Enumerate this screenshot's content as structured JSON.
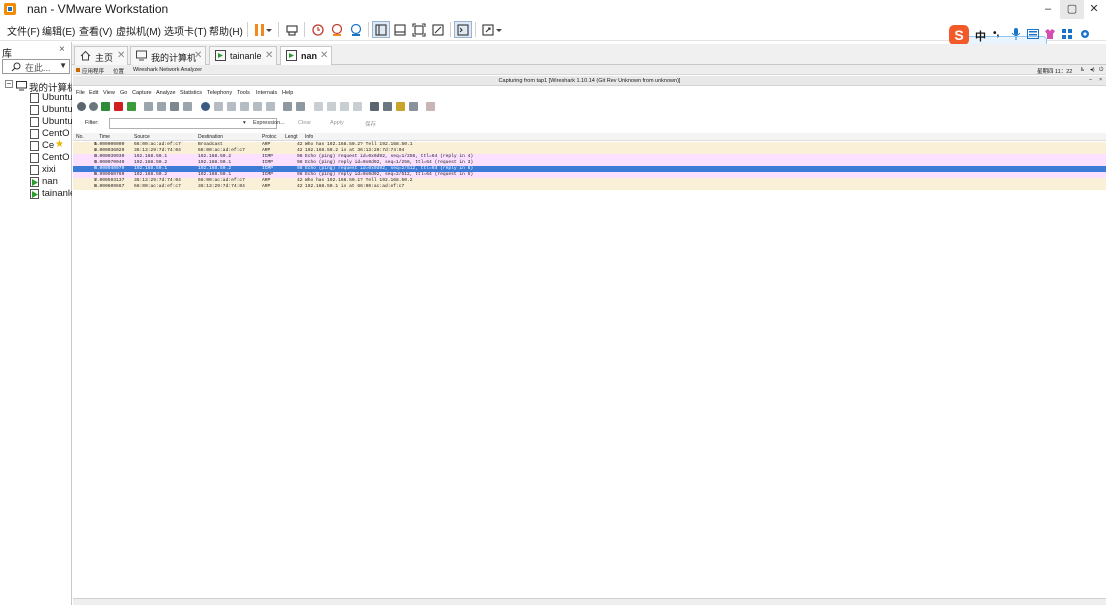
{
  "window": {
    "title": "nan - VMware Workstation",
    "minimize": "–",
    "restore": "▢",
    "close": "✕"
  },
  "menubar": {
    "items": [
      "文件(F)",
      "编辑(E)",
      "查看(V)",
      "虚拟机(M)",
      "选项卡(T)",
      "帮助(H)"
    ]
  },
  "library": {
    "title": "库",
    "close": "×",
    "search_placeholder": "在此...",
    "root": "我的计算机",
    "items": [
      "Ubuntu",
      "Ubuntu",
      "Ubuntu",
      "CentO",
      "Ce",
      "CentO",
      "xixi",
      "nan",
      "tainanle"
    ]
  },
  "tabs": [
    {
      "label": "主页",
      "icon": "home-icon"
    },
    {
      "label": "我的计算机",
      "icon": "computer-icon"
    },
    {
      "label": "tainanle",
      "icon": "vm-icon"
    },
    {
      "label": "nan",
      "icon": "vm-icon",
      "active": true
    }
  ],
  "guest": {
    "topbar": {
      "apps": "应用程序",
      "places": "位置",
      "app_name": "Wireshark Network Analyzer",
      "clock": "星期四 11：22"
    },
    "capture_title": "Capturing from tap1   [Wireshark 1.10.14  (Git Rev Unknown from unknown)]",
    "menu": [
      "File",
      "Edit",
      "View",
      "Go",
      "Capture",
      "Analyze",
      "Statistics",
      "Telephony",
      "Tools",
      "Internals",
      "Help"
    ],
    "filter": {
      "label": "Filter:",
      "expression": "Expression...",
      "clear": "Clear",
      "apply": "Apply",
      "save": "保存"
    },
    "columns": [
      "No.",
      "Time",
      "Source",
      "Destination",
      "Protoc",
      "Lengt",
      "Info"
    ],
    "packets": [
      {
        "no": "1",
        "time": "0.000000000",
        "src": "66:00:ac:ad:ef:c7",
        "dst": "Broadcast",
        "proto": "ARP",
        "len": "42",
        "info": "Who has 192.168.50.2?  Tell 192.168.50.1",
        "kind": "arp"
      },
      {
        "no": "2",
        "time": "0.000036029",
        "src": "36:13:29:7d:74:04",
        "dst": "66:00:ac:ad:ef:c7",
        "proto": "ARP",
        "len": "42",
        "info": "192.168.50.2 is at 36:13:29:7d:74:04",
        "kind": "arp"
      },
      {
        "no": "3",
        "time": "0.000039930",
        "src": "192.168.50.1",
        "dst": "192.168.50.2",
        "proto": "ICMP",
        "len": "98",
        "info": "Echo (ping) request  id=0x0d92, seq=1/256, ttl=64 (reply in 4)",
        "kind": "icmp"
      },
      {
        "no": "4",
        "time": "0.000070040",
        "src": "192.168.50.2",
        "dst": "192.168.50.1",
        "proto": "ICMP",
        "len": "98",
        "info": "Echo (ping) reply    id=0x0d92, seq=1/256, ttl=64 (request in 3)",
        "kind": "icmp"
      },
      {
        "no": "5",
        "time": "0.000940970",
        "src": "192.168.50.1",
        "dst": "192.168.50.2",
        "proto": "ICMP",
        "len": "98",
        "info": "Echo (ping) request  id=0x0d92, seq=2/512, ttl=64 (reply in 6)",
        "kind": "sel"
      },
      {
        "no": "6",
        "time": "0.999960760",
        "src": "192.168.50.2",
        "dst": "192.168.50.1",
        "proto": "ICMP",
        "len": "98",
        "info": "Echo (ping) reply    id=0x0d92, seq=2/512, ttl=64 (request in 5)",
        "kind": "icmp"
      },
      {
        "no": "7",
        "time": "5.000593137",
        "src": "36:13:29:7d:74:04",
        "dst": "66:00:ac:ad:ef:c7",
        "proto": "ARP",
        "len": "42",
        "info": "Who has 192.168.50.1?  Tell 192.168.50.2",
        "kind": "arp"
      },
      {
        "no": "8",
        "time": "5.000609567",
        "src": "66:00:ac:ad:ef:c7",
        "dst": "36:13:29:7d:74:04",
        "proto": "ARP",
        "len": "42",
        "info": "192.168.50.1 is at 66:00:ac:ad:ef:c7",
        "kind": "arp"
      }
    ]
  },
  "ime": {
    "lang": "中",
    "punct": "•,"
  },
  "colors": {
    "accent": "#3d7bd6",
    "arp_row": "#faf0d7",
    "icmp_row": "#fce0ff",
    "pause_orange": "#f08a1c"
  }
}
